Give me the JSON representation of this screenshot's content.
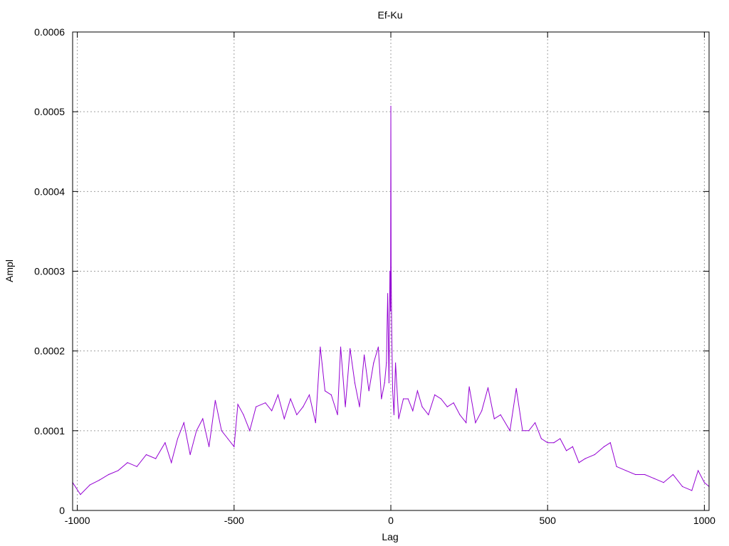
{
  "chart_data": {
    "type": "line",
    "title": "Ef-Ku",
    "xlabel": "Lag",
    "ylabel": "Ampl",
    "xlim": [
      -1015,
      1015
    ],
    "ylim": [
      0,
      0.0006
    ],
    "x_ticks": [
      -1000,
      -500,
      0,
      500,
      1000
    ],
    "x_tick_labels": [
      "-1000",
      "-500",
      "0",
      "500",
      "1000"
    ],
    "y_ticks": [
      0,
      0.0001,
      0.0002,
      0.0003,
      0.0004,
      0.0005,
      0.0006
    ],
    "y_tick_labels": [
      "0",
      "0.0001",
      "0.0002",
      "0.0003",
      "0.0004",
      "0.0005",
      "0.0006"
    ],
    "grid": true,
    "legend": "none",
    "series_color": "#9400d3",
    "series": [
      {
        "x": [
          -1015,
          -990,
          -960,
          -930,
          -900,
          -870,
          -840,
          -810,
          -780,
          -750,
          -720,
          -700,
          -680,
          -660,
          -640,
          -620,
          -600,
          -580,
          -560,
          -540,
          -520,
          -500,
          -488,
          -470,
          -450,
          -430,
          -400,
          -380,
          -360,
          -340,
          -320,
          -300,
          -280,
          -260,
          -240,
          -225,
          -210,
          -190,
          -170,
          -160,
          -145,
          -130,
          -115,
          -100,
          -85,
          -70,
          -55,
          -40,
          -30,
          -20,
          -14,
          -10,
          -6,
          -3,
          -1,
          0,
          1,
          3,
          6,
          10,
          15,
          25,
          40,
          55,
          70,
          85,
          100,
          120,
          140,
          160,
          180,
          200,
          220,
          240,
          250,
          270,
          290,
          310,
          330,
          350,
          380,
          400,
          420,
          440,
          460,
          480,
          500,
          520,
          540,
          560,
          580,
          600,
          620,
          650,
          680,
          700,
          720,
          750,
          780,
          810,
          840,
          870,
          900,
          930,
          960,
          980,
          1000,
          1015
        ],
        "y": [
          3.5e-05,
          2e-05,
          3.2e-05,
          3.8e-05,
          4.5e-05,
          5e-05,
          6e-05,
          5.5e-05,
          7e-05,
          6.5e-05,
          8.5e-05,
          6e-05,
          9e-05,
          0.00011,
          7e-05,
          0.0001,
          0.000115,
          8e-05,
          0.000138,
          0.0001,
          9e-05,
          8e-05,
          0.000133,
          0.00012,
          0.0001,
          0.00013,
          0.000135,
          0.000125,
          0.000145,
          0.000115,
          0.00014,
          0.00012,
          0.00013,
          0.000145,
          0.00011,
          0.000205,
          0.00015,
          0.000145,
          0.00012,
          0.000205,
          0.00013,
          0.000203,
          0.00016,
          0.00013,
          0.000195,
          0.00015,
          0.000185,
          0.000205,
          0.00014,
          0.00016,
          0.000185,
          0.000272,
          0.00016,
          0.0003,
          0.00025,
          0.000507,
          0.000305,
          0.00022,
          0.00015,
          0.00012,
          0.000185,
          0.000115,
          0.00014,
          0.00014,
          0.000125,
          0.00015,
          0.00013,
          0.00012,
          0.000145,
          0.00014,
          0.00013,
          0.000135,
          0.00012,
          0.00011,
          0.000155,
          0.00011,
          0.000125,
          0.000154,
          0.000115,
          0.00012,
          0.0001,
          0.000153,
          0.0001,
          0.0001,
          0.00011,
          9e-05,
          8.5e-05,
          8.5e-05,
          9e-05,
          7.5e-05,
          8e-05,
          6e-05,
          6.5e-05,
          7e-05,
          8e-05,
          8.5e-05,
          5.5e-05,
          5e-05,
          4.5e-05,
          4.5e-05,
          4e-05,
          3.5e-05,
          4.5e-05,
          3e-05,
          2.5e-05,
          5e-05,
          3.5e-05,
          3e-05
        ]
      }
    ]
  }
}
